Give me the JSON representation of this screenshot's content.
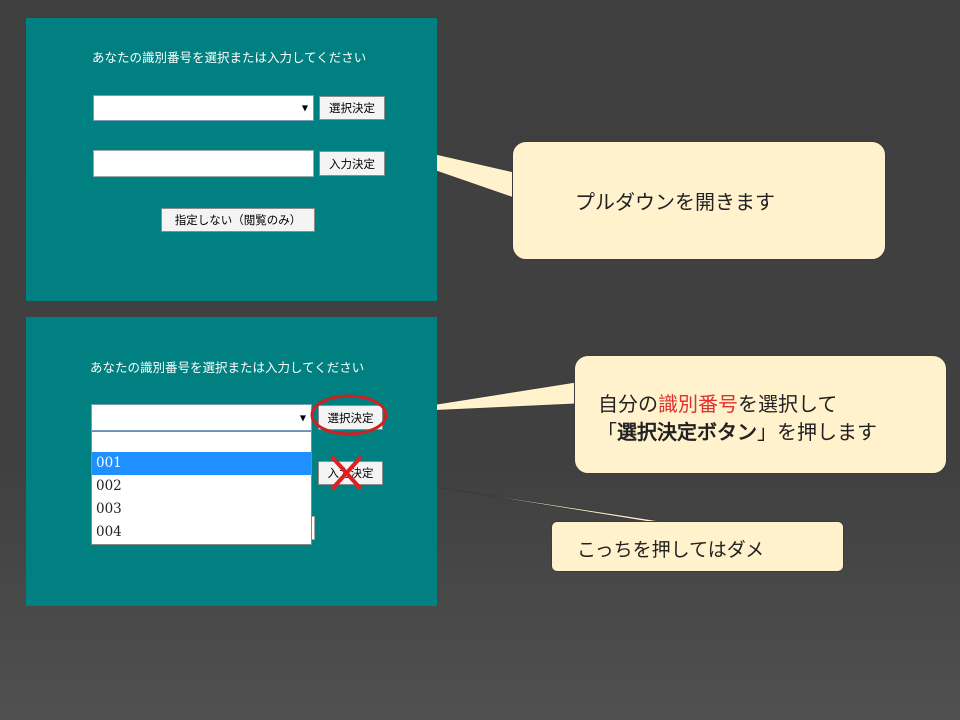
{
  "panel_top": {
    "prompt": "あなたの識別番号を選択または入力してください",
    "select_button": "選択決定",
    "input_button": "入力決定",
    "no_specify_button": "指定しない（閲覧のみ）"
  },
  "panel_bottom": {
    "prompt": "あなたの識別番号を選択または入力してください",
    "select_button": "選択決定",
    "input_button": "入力決定",
    "dropdown_options": [
      "001",
      "002",
      "003",
      "004"
    ],
    "dropdown_selected": "001"
  },
  "callouts": {
    "open_pulldown": "プルダウンを開きます",
    "select_line1_prefix": "自分の",
    "select_line1_highlight": "識別番号",
    "select_line1_suffix": "を選択して",
    "select_line2_open": "「",
    "select_line2_bold": "選択決定ボタン",
    "select_line2_close": "」を押します",
    "dont_press": "こっちを押してはダメ"
  },
  "colors": {
    "panel_bg": "#008080",
    "callout_bg": "#fff2cc",
    "highlight_red": "#e03030",
    "selected_option": "#1e90ff"
  },
  "icons": {
    "dropdown_arrow": "triangle-down",
    "forbidden_mark": "red-x",
    "highlight_circle": "red-ellipse"
  }
}
